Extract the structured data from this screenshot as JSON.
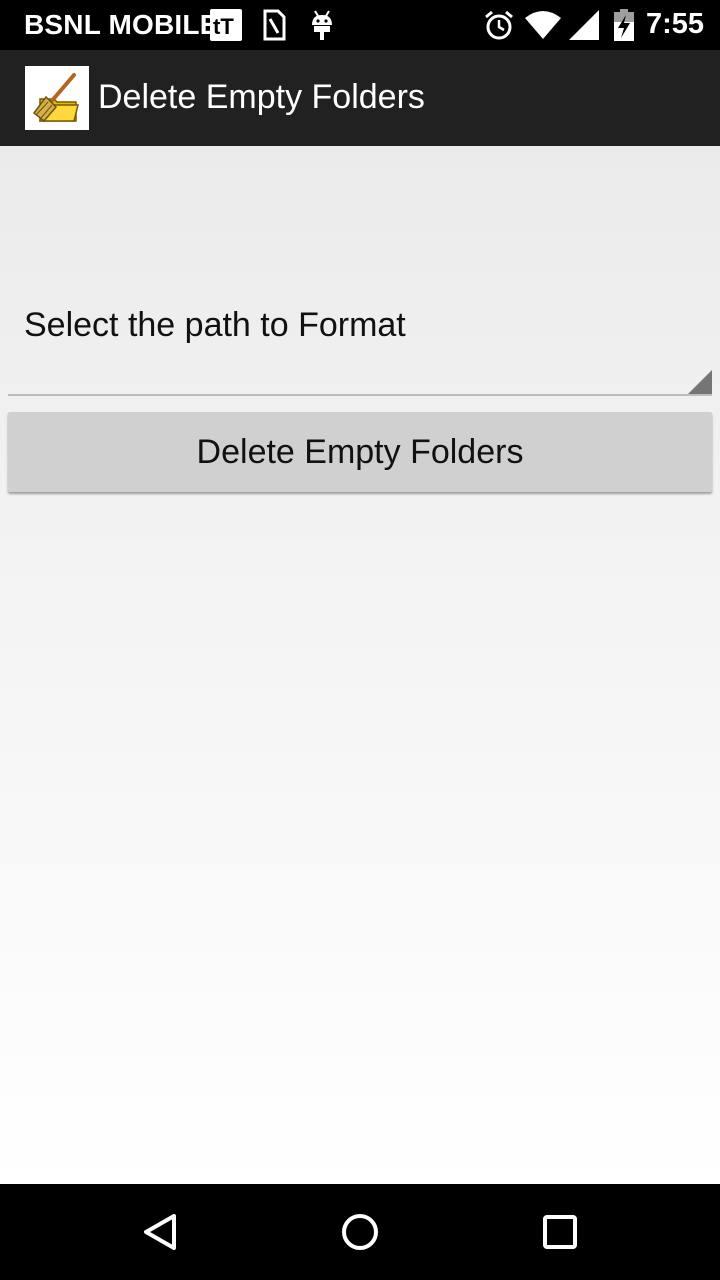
{
  "status_bar": {
    "carrier": "BSNL MOBILE",
    "time": "7:55",
    "icons": [
      "tt-news-icon",
      "sim-card-icon",
      "android-debug-icon",
      "alarm-icon",
      "wifi-icon",
      "cell-signal-icon",
      "battery-charging-icon"
    ]
  },
  "action_bar": {
    "title": "Delete Empty Folders",
    "app_icon": "broom-folder-icon",
    "background": "#212121"
  },
  "main": {
    "spinner_selected": "Select the path to Format",
    "delete_button_label": "Delete Empty Folders"
  },
  "nav_bar": {
    "buttons": [
      "back-icon",
      "home-icon",
      "recents-icon"
    ]
  },
  "colors": {
    "status_bar": "#000000",
    "action_bar": "#212121",
    "button": "#d0d0d0",
    "content_top": "#ebebeb",
    "content_bottom": "#ffffff"
  }
}
